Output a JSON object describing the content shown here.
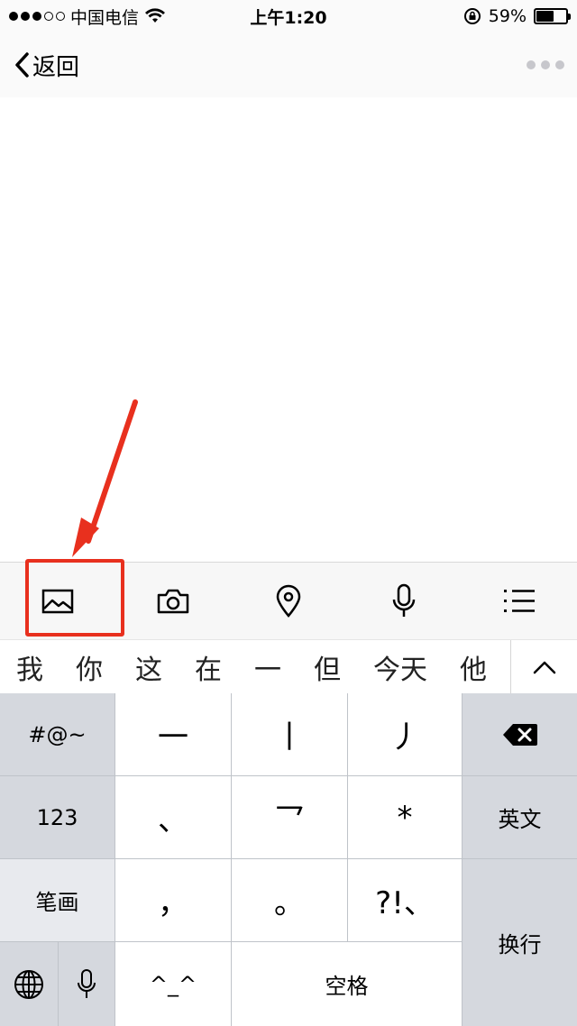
{
  "status_bar": {
    "carrier": "中国电信",
    "time": "上午1:20",
    "battery_percent": "59%",
    "battery_level": 0.59,
    "signal_bars_filled": 3,
    "signal_bars_total": 5
  },
  "nav": {
    "back_label": "返回",
    "more_icon": "more-dots-icon"
  },
  "toolbar": {
    "items": [
      {
        "icon": "image-icon"
      },
      {
        "icon": "camera-icon"
      },
      {
        "icon": "location-pin-icon"
      },
      {
        "icon": "microphone-icon"
      },
      {
        "icon": "list-icon"
      }
    ]
  },
  "candidates": {
    "items": [
      "我",
      "你",
      "这",
      "在",
      "一",
      "但",
      "今天",
      "他"
    ],
    "expand_icon": "chevron-up-icon"
  },
  "keyboard": {
    "symbols_key": "#@~",
    "numbers_key": "123",
    "stroke_key": "笔画",
    "english_key": "英文",
    "enter_key": "换行",
    "space_key": "空格",
    "emoticon_key": "^_^",
    "punct_key": "?!、",
    "comma_key": "，",
    "period_key": "。",
    "stroke_heng": "一",
    "stroke_shu": "丨",
    "stroke_pie": "丿",
    "stroke_dian": "、",
    "stroke_zhe": "乛",
    "wildcard": "*"
  },
  "colors": {
    "highlight": "#e8301e",
    "keyboard_bg": "#bfc3c9"
  }
}
